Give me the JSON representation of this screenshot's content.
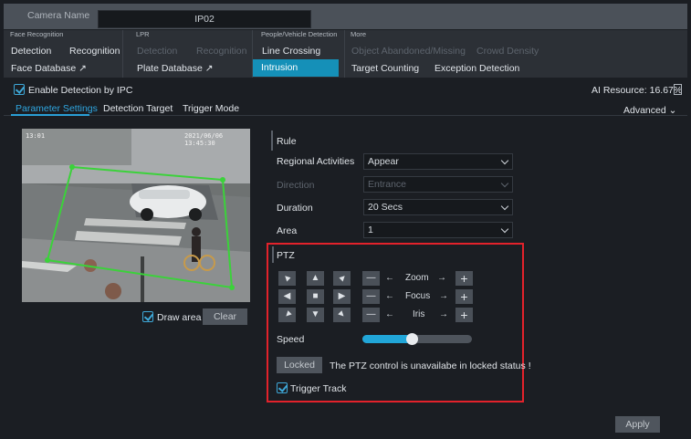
{
  "header": {
    "camera_label": "Camera Name",
    "camera_value": "IP02"
  },
  "menu": {
    "groups": [
      "Face Recognition",
      "LPR",
      "People/Vehicle Detection",
      "More"
    ],
    "row1": [
      "Detection",
      "Recognition",
      "Detection",
      "Recognition",
      "Line Crossing",
      "Object Abandoned/Missing",
      "Crowd Density"
    ],
    "row2": [
      "Face Database",
      "Plate Database",
      "Intrusion",
      "Target Counting",
      "Exception Detection"
    ]
  },
  "enable_ipc_label": "Enable Detection by IPC",
  "ai_resource": "AI Resource: 16.67%",
  "subtabs": [
    "Parameter Settings",
    "Detection Target",
    "Trigger Mode"
  ],
  "advanced_label": "Advanced",
  "video": {
    "time_left": "13:01",
    "time_right": "2021/06/06 13:45:30"
  },
  "draw_area_label": "Draw area",
  "clear_label": "Clear",
  "rule": {
    "title": "Rule",
    "fields": [
      {
        "label": "Regional Activities",
        "value": "Appear"
      },
      {
        "label": "Direction",
        "value": "Entrance"
      },
      {
        "label": "Duration",
        "value": "20 Secs"
      },
      {
        "label": "Area",
        "value": "1"
      }
    ]
  },
  "ptz": {
    "title": "PTZ",
    "zoom_label": "Zoom",
    "focus_label": "Focus",
    "iris_label": "Iris",
    "speed_label": "Speed",
    "speed_value": 0.45,
    "locked_label": "Locked",
    "locked_message": "The PTZ control is unavailabe in locked status !",
    "trigger_track_label": "Trigger Track"
  },
  "apply_label": "Apply",
  "colors": {
    "accent": "#1590b8",
    "highlight": "#e3222b",
    "area_line": "#3bd23a"
  },
  "icons": {
    "dir_up": "▲",
    "dir_down": "▼",
    "dir_left": "◀",
    "dir_right": "▶",
    "center": "■",
    "minus": "—",
    "plus": "+"
  }
}
